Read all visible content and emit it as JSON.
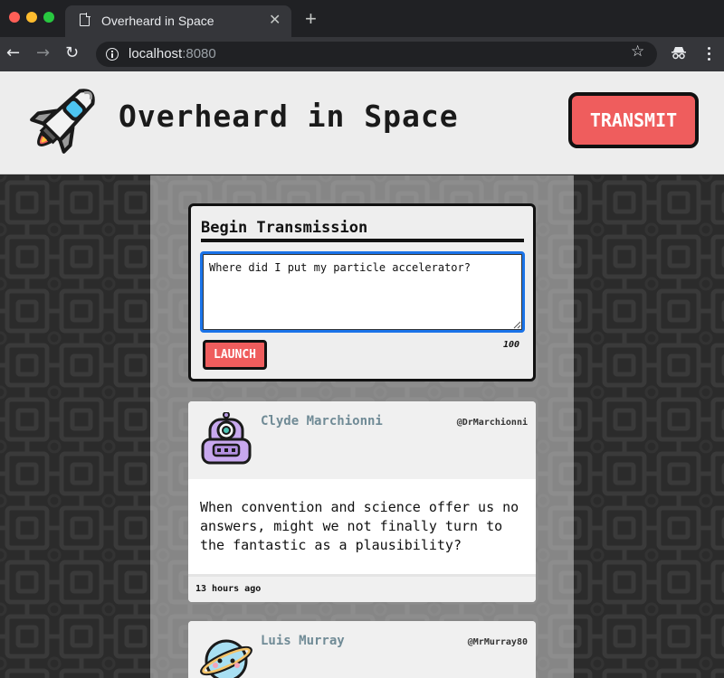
{
  "browser": {
    "tab_title": "Overheard in Space",
    "tab_close": "✕",
    "new_tab": "+",
    "url_host": "localhost",
    "url_port": ":8080",
    "back": "←",
    "forward": "→",
    "reload": "↻",
    "star": "☆"
  },
  "header": {
    "title": "Overheard in Space",
    "transmit_label": "TRANSMIT",
    "logo": "rocket-icon"
  },
  "compose": {
    "title": "Begin Transmission",
    "value": "Where did I put my particle accelerator?",
    "launch_label": "LAUNCH",
    "char_count": "100"
  },
  "posts": [
    {
      "name": "Clyde Marchionni",
      "handle": "@DrMarchionni",
      "avatar": "robot-avatar",
      "body": "When convention and science offer us no answers, might we not finally turn to the fantastic as a plausibility?",
      "time": "13 hours ago"
    },
    {
      "name": "Luis Murray",
      "handle": "@MrMurray80",
      "avatar": "planet-avatar"
    }
  ],
  "colors": {
    "accent": "#ef5d5d",
    "name": "#708b96",
    "header_bg": "#ededed",
    "page_bg": "#2b2b2b"
  }
}
